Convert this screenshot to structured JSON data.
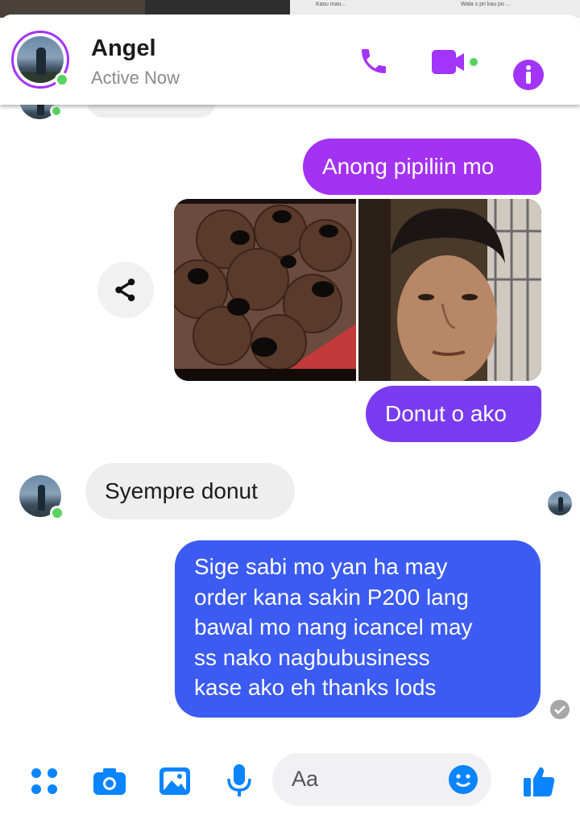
{
  "header": {
    "contact_name": "Angel",
    "status": "Active Now",
    "icons": [
      "phone-icon",
      "video-call-icon",
      "info-icon"
    ],
    "accent_color": "#a334fa"
  },
  "top_strip": {
    "left_text": "Kasu mau...",
    "right_text": "Wala s pri kau po ..."
  },
  "messages": [
    {
      "direction": "outgoing",
      "type": "text",
      "text": "Anong pipiliin mo"
    },
    {
      "direction": "outgoing",
      "type": "photos",
      "items": [
        "donuts-photo",
        "man-selfie-photo"
      ]
    },
    {
      "direction": "outgoing",
      "type": "text",
      "text": "Donut o ako"
    },
    {
      "direction": "incoming",
      "type": "text",
      "text": "Syempre donut"
    },
    {
      "direction": "outgoing",
      "type": "text",
      "lines": [
        "Sige sabi mo yan ha may",
        "order kana sakin P200 lang",
        "bawal mo nang icancel may",
        "ss nako nagbubusiness",
        "kase ako eh thanks lods"
      ]
    }
  ],
  "composer": {
    "placeholder": "Aa",
    "icons": [
      "apps-icon",
      "camera-icon",
      "gallery-icon",
      "microphone-icon",
      "emoji-icon",
      "thumbs-up-icon"
    ],
    "accent_color": "#0a84ff"
  },
  "colors": {
    "outgoing_purple": "#a332f3",
    "outgoing_blue": "#3b5bf2",
    "incoming_gray": "#eeeeee",
    "online_green": "#5ad25f"
  }
}
